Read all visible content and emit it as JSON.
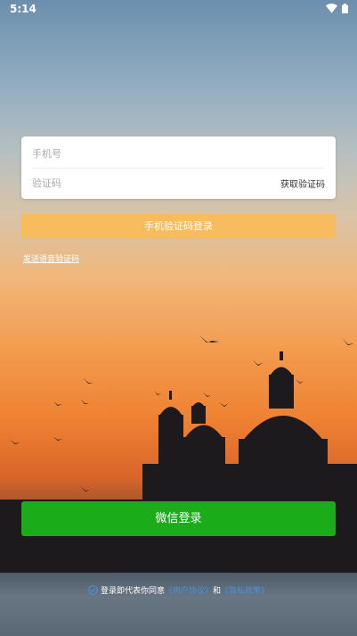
{
  "status_bar": {
    "time": "5:14",
    "wifi_icon": "wifi-icon",
    "battery_icon": "battery-icon"
  },
  "login_form": {
    "phone_placeholder": "手机号",
    "phone_value": "",
    "code_placeholder": "验证码",
    "code_value": "",
    "get_code_label": "获取验证码"
  },
  "sms_login_label": "手机验证码登录",
  "voice_code_label": "发送语音验证码",
  "wechat_login_label": "微信登录",
  "agreement": {
    "check_icon": "check-circle-icon",
    "prefix": "登录即代表你同意",
    "user_agreement": "《用户协议》",
    "conjunction": "和",
    "privacy_policy": "《隐私政策》"
  },
  "colors": {
    "sms_button": "#f6bc5d",
    "wechat_button": "#1aad19",
    "link": "#4a90e2"
  }
}
